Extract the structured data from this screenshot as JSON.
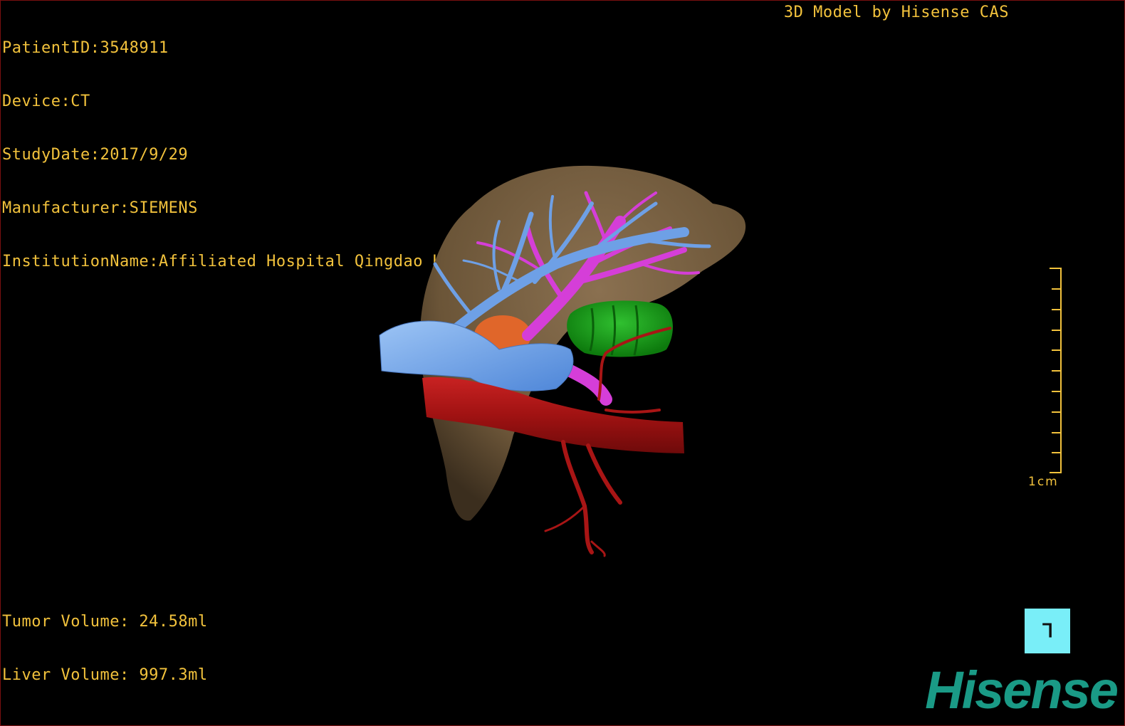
{
  "header": {
    "patient_id": "PatientID:3548911",
    "device": "Device:CT",
    "study_date": "StudyDate:2017/9/29",
    "manufacturer": "Manufacturer:SIEMENS",
    "institution": "InstitutionName:Affiliated Hospital Qingdao University-C",
    "brand_caption": "3D Model by Hisense CAS"
  },
  "scale": {
    "label": "1cm"
  },
  "orientation": {
    "glyph": "ᒣ"
  },
  "footer": {
    "tumor_volume": "Tumor Volume: 24.58ml",
    "liver_volume": "Liver Volume: 997.3ml"
  },
  "logo": {
    "text": "Hisense"
  },
  "colors": {
    "overlay_text": "#f2c23c",
    "liver": "#7a6344",
    "portal_vein": "#6ea0e6",
    "hepatic_vein": "#d53ed8",
    "tumor": "#e0662a",
    "gallbladder_or_organ": "#1aa01a",
    "artery": "#b01515",
    "orientation_cube": "#79eef8",
    "logo": "#1a9a86"
  }
}
